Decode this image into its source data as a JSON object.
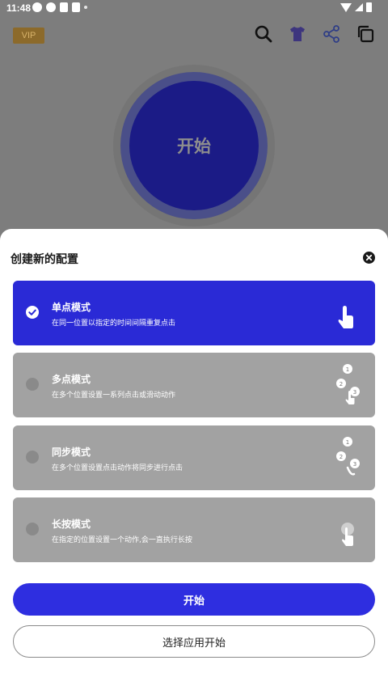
{
  "status_bar": {
    "time": "11:48"
  },
  "header": {
    "vip_label": "VIP"
  },
  "main": {
    "start_circle_label": "开始"
  },
  "sheet": {
    "title": "创建新的配置",
    "modes": [
      {
        "name": "单点模式",
        "desc": "在同一位置以指定的时间间隔重复点击",
        "selected": true,
        "icon": "single-tap-icon"
      },
      {
        "name": "多点模式",
        "desc": "在多个位置设置一系列点击或滑动动作",
        "selected": false,
        "icon": "multi-tap-icon"
      },
      {
        "name": "同步模式",
        "desc": "在多个位置设置点击动作将同步进行点击",
        "selected": false,
        "icon": "sync-tap-icon"
      },
      {
        "name": "长按模式",
        "desc": "在指定的位置设置一个动作,会一直执行长按",
        "selected": false,
        "icon": "long-press-icon"
      }
    ],
    "start_button": "开始",
    "select_app_button": "选择应用开始"
  },
  "colors": {
    "accent": "#2E2EE0",
    "selected_card": "#2A2AD6",
    "unselected_card": "#A2A2A2",
    "dim_overlay": "#7D7D7D",
    "vip_badge": "#8C6A2B"
  }
}
